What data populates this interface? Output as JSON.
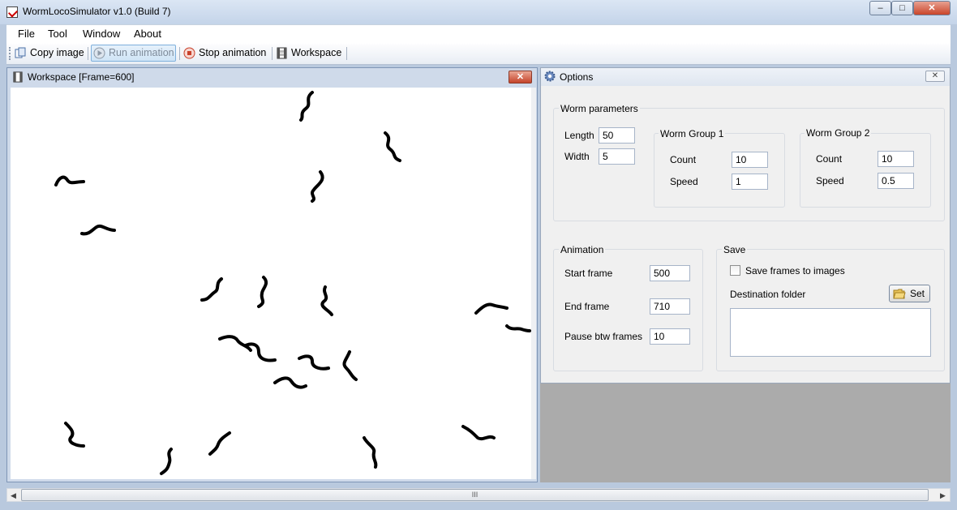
{
  "window": {
    "title": "WormLocoSimulator  v1.0 (Build 7)",
    "minimize": "–",
    "maximize": "□",
    "close": "✕"
  },
  "menu": [
    "File",
    "Tool",
    "Window",
    "About"
  ],
  "toolbar": {
    "copy_image": "Copy image",
    "run_animation": "Run animation",
    "stop_animation": "Stop animation",
    "workspace": "Workspace"
  },
  "workspace": {
    "title": "Workspace   [Frame=600]",
    "close": "✕"
  },
  "options": {
    "title": "Options",
    "close": "✕",
    "worm_parameters": {
      "label": "Worm parameters",
      "length_label": "Length",
      "length_value": "50",
      "width_label": "Width",
      "width_value": "5",
      "group1": {
        "label": "Worm Group 1",
        "count_label": "Count",
        "count_value": "10",
        "speed_label": "Speed",
        "speed_value": "1"
      },
      "group2": {
        "label": "Worm Group 2",
        "count_label": "Count",
        "count_value": "10",
        "speed_label": "Speed",
        "speed_value": "0.5"
      }
    },
    "animation": {
      "label": "Animation",
      "start_label": "Start frame",
      "start_value": "500",
      "end_label": "End frame",
      "end_value": "710",
      "pause_label": "Pause btw frames",
      "pause_value": "10"
    },
    "save": {
      "label": "Save",
      "checkbox_label": "Save frames to images",
      "checked": false,
      "dest_label": "Destination folder",
      "set_button": "Set",
      "dest_value": ""
    }
  },
  "scrollbar": {
    "grip": "III",
    "left": "◀",
    "right": "▶"
  }
}
